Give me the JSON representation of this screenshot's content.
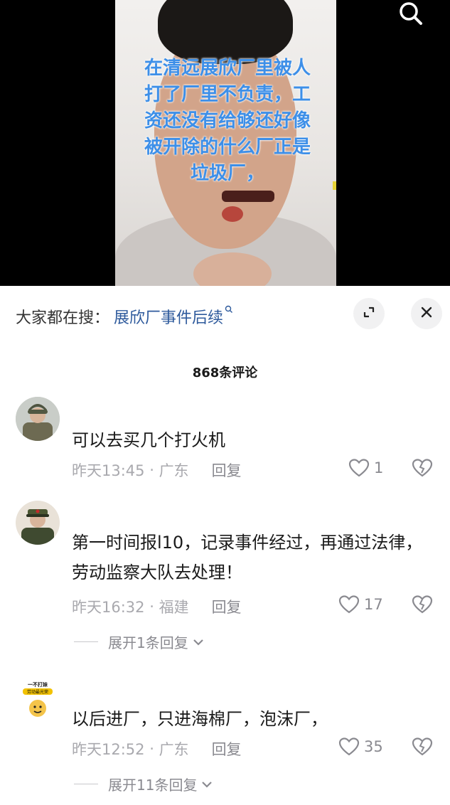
{
  "video": {
    "overlay_text": "在清远展欣厂里被人打了厂里不负责，工资还没有给够还好像被开除的什么厂正是垃圾厂，"
  },
  "search": {
    "label": "大家都在搜：",
    "term": "展欣厂事件后续"
  },
  "comments_header": {
    "count_label": "868条评论"
  },
  "comments": [
    {
      "text": "可以去买几个打火机",
      "time": "昨天13:45",
      "location": "广东",
      "reply_label": "回复",
      "likes": "1"
    },
    {
      "text": "第一时间报l10，记录事件经过，再通过法律，劳动监察大队去处理！",
      "time": "昨天16:32",
      "location": "福建",
      "reply_label": "回复",
      "likes": "17",
      "expand_label": "展开1条回复"
    },
    {
      "text": "以后进厂，只进海棉厂，泡沫厂，",
      "time": "昨天12:52",
      "location": "广东",
      "reply_label": "回复",
      "likes": "35",
      "expand_label": "展开11条回复"
    }
  ],
  "avatar3_caption": {
    "line1": "一不打妹",
    "line2": "劳动最光荣"
  },
  "colors": {
    "overlay_text": "#3d8fe8",
    "search_term": "#2e5a9c",
    "meta_gray": "#a9a9ae"
  }
}
